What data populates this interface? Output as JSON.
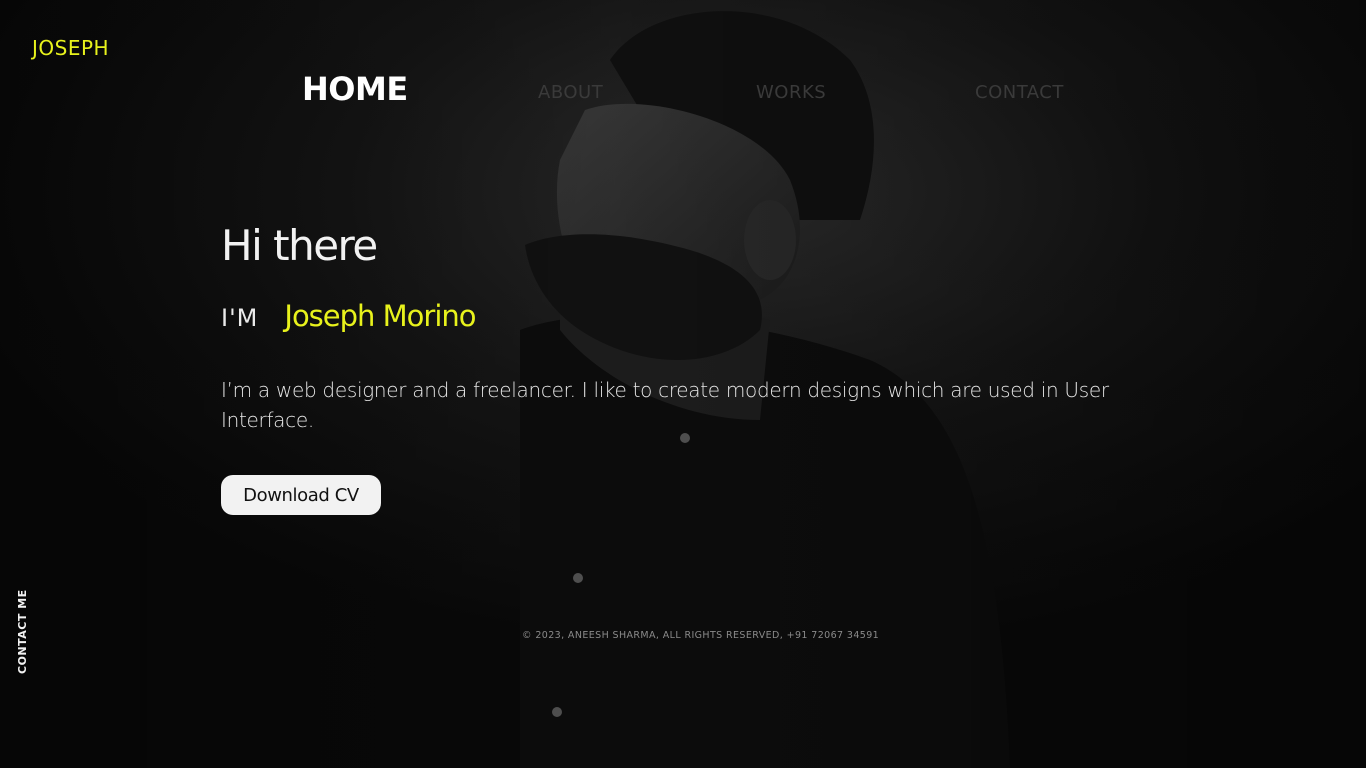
{
  "brand": {
    "logo_text": "JOSEPH",
    "accent_color": "#e8f21c"
  },
  "nav": {
    "items": [
      {
        "label": "HOME",
        "active": true
      },
      {
        "label": "ABOUT",
        "active": false
      },
      {
        "label": "WORKS",
        "active": false
      },
      {
        "label": "CONTACT",
        "active": false
      }
    ]
  },
  "hero": {
    "greeting": "Hi there",
    "iam_prefix": "I'M",
    "name": "Joseph Morino",
    "bio": "I’m a web designer and a freelancer. I like to create modern designs which are used in User Interface.",
    "cta_label": "Download CV"
  },
  "footer": {
    "copyright": "© 2023, ANEESH SHARMA, ALL RIGHTS RESERVED, +91 72067 34591"
  },
  "side": {
    "contact_label": "CONTACT ME"
  },
  "background": {
    "image": "grayscale-portrait-bearded-man"
  }
}
